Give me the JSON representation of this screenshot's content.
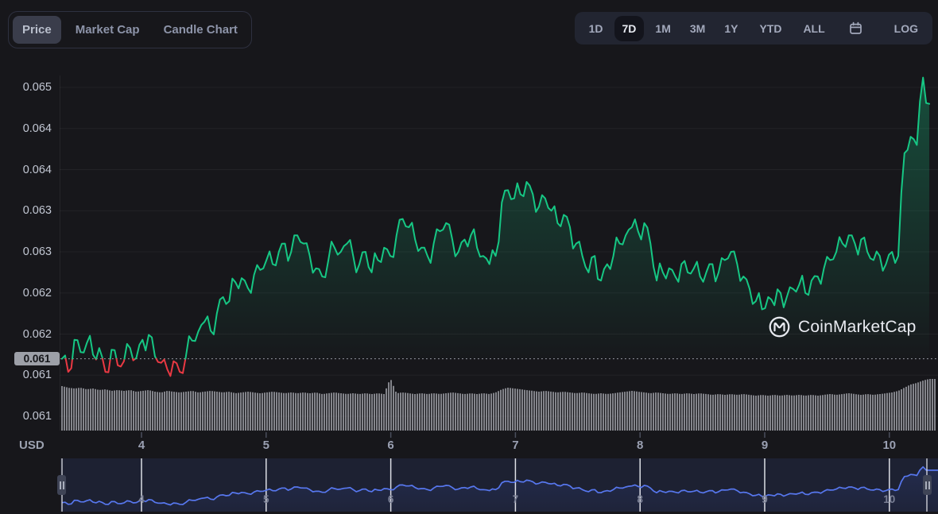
{
  "toolbar": {
    "view_tabs": [
      {
        "label": "Price",
        "selected": true
      },
      {
        "label": "Market Cap",
        "selected": false
      },
      {
        "label": "Candle Chart",
        "selected": false
      }
    ],
    "ranges": [
      {
        "label": "1D",
        "selected": false
      },
      {
        "label": "7D",
        "selected": true
      },
      {
        "label": "1M",
        "selected": false
      },
      {
        "label": "3M",
        "selected": false
      },
      {
        "label": "1Y",
        "selected": false
      },
      {
        "label": "YTD",
        "selected": false
      },
      {
        "label": "ALL",
        "selected": false
      },
      {
        "icon": "calendar"
      },
      {
        "label": "LOG",
        "selected": false
      }
    ]
  },
  "watermark": {
    "text": "CoinMarketCap"
  },
  "axis_unit_label": "USD",
  "chart_data": {
    "type": "line",
    "ylabel": "USD",
    "legend": "none",
    "grid": "horizontal",
    "x_tick_labels": [
      "4",
      "5",
      "6",
      "7",
      "8",
      "9",
      "10"
    ],
    "x_tick_days": [
      4,
      5,
      6,
      7,
      8,
      9,
      10
    ],
    "day_start": 3.362,
    "day_end": 10.322,
    "y_ticks": [
      {
        "price": 0.065,
        "label": "0.065"
      },
      {
        "price": 0.0645,
        "label": "0.064"
      },
      {
        "price": 0.064,
        "label": "0.064"
      },
      {
        "price": 0.0635,
        "label": "0.063"
      },
      {
        "price": 0.063,
        "label": "0.063"
      },
      {
        "price": 0.0625,
        "label": "0.062"
      },
      {
        "price": 0.062,
        "label": "0.062"
      },
      {
        "price": 0.0615,
        "label": "0.061"
      },
      {
        "price": 0.061,
        "label": "0.061"
      }
    ],
    "baseline_price": 0.0617,
    "baseline_label": "0.061",
    "prices_usd": [
      0.0617,
      0.06154,
      0.06193,
      0.06178,
      0.06189,
      0.06175,
      0.06183,
      0.06154,
      0.06181,
      0.06162,
      0.06167,
      0.06183,
      0.06171,
      0.06193,
      0.06199,
      0.06173,
      0.06165,
      0.06157,
      0.06167,
      0.06154,
      0.06173,
      0.06192,
      0.06203,
      0.06215,
      0.06204,
      0.06225,
      0.06245,
      0.0624,
      0.06263,
      0.06268,
      0.06256,
      0.06272,
      0.06278,
      0.0629,
      0.06285,
      0.063,
      0.0631,
      0.063,
      0.0632,
      0.0631,
      0.06295,
      0.0628,
      0.0627,
      0.0629,
      0.06305,
      0.063,
      0.0631,
      0.06295,
      0.06285,
      0.063,
      0.06275,
      0.0629,
      0.06305,
      0.06295,
      0.0632,
      0.0634,
      0.0633,
      0.06315,
      0.06305,
      0.06295,
      0.0631,
      0.06325,
      0.06335,
      0.06315,
      0.063,
      0.06315,
      0.0632,
      0.06305,
      0.06295,
      0.06285,
      0.06295,
      0.0636,
      0.06375,
      0.06365,
      0.0637,
      0.06385,
      0.0637,
      0.06355,
      0.06365,
      0.0635,
      0.06335,
      0.06345,
      0.0633,
      0.0631,
      0.06295,
      0.06275,
      0.06295,
      0.06265,
      0.06285,
      0.06295,
      0.0631,
      0.0632,
      0.0633,
      0.06325,
      0.06335,
      0.0631,
      0.06265,
      0.06275,
      0.0628,
      0.0627,
      0.06285,
      0.06275,
      0.0628,
      0.0627,
      0.06275,
      0.06285,
      0.06275,
      0.0629,
      0.063,
      0.06285,
      0.0627,
      0.06255,
      0.0624,
      0.0623,
      0.06245,
      0.06235,
      0.0625,
      0.06245,
      0.06255,
      0.0626,
      0.0625,
      0.06265,
      0.0627,
      0.0628,
      0.0629,
      0.063,
      0.0631,
      0.0632,
      0.0631,
      0.06315,
      0.063,
      0.0629,
      0.06295,
      0.06285,
      0.063,
      0.06295,
      0.0642,
      0.0644,
      0.0643,
      0.06512,
      0.0648
    ],
    "texture": {
      "midpoint_jitter_usd": [
        0.00012,
        -0.00015,
        7e-05,
        -6e-05,
        0.00016,
        -0.0001,
        3e-05,
        -0.00014,
        9e-05,
        -4e-05,
        0.00013,
        -9e-05,
        5e-05,
        -0.00016,
        0.0001,
        -3e-05,
        8e-05,
        -0.00013,
        4e-05,
        -0.00011,
        0.00015,
        -6e-05,
        2e-05
      ],
      "note": "small oscillation inserted at midpoints of the sampled series to reproduce the high-frequency texture of the drawn line"
    },
    "volume_rel": [
      56,
      54,
      53,
      54,
      52,
      53,
      51,
      52,
      50,
      51,
      50,
      51,
      49,
      50,
      51,
      49,
      48,
      50,
      49,
      48,
      49,
      50,
      48,
      49,
      50,
      49,
      48,
      49,
      47,
      48,
      49,
      48,
      47,
      48,
      49,
      48,
      47,
      48,
      47,
      48,
      47,
      48,
      46,
      47,
      48,
      47,
      46,
      47,
      46,
      47,
      46,
      47,
      46,
      66,
      47,
      48,
      47,
      46,
      47,
      46,
      47,
      46,
      47,
      48,
      47,
      46,
      47,
      46,
      47,
      46,
      48,
      52,
      54,
      53,
      52,
      51,
      50,
      49,
      50,
      49,
      48,
      49,
      48,
      47,
      48,
      47,
      46,
      47,
      46,
      47,
      48,
      49,
      50,
      49,
      48,
      47,
      48,
      47,
      46,
      47,
      46,
      47,
      46,
      47,
      46,
      45,
      46,
      45,
      46,
      45,
      46,
      45,
      44,
      45,
      44,
      45,
      44,
      45,
      44,
      45,
      44,
      45,
      44,
      45,
      46,
      45,
      46,
      47,
      46,
      45,
      46,
      45,
      46,
      47,
      48,
      50,
      54,
      58,
      60,
      63,
      65
    ],
    "colors": {
      "up": "#16c784",
      "down": "#ea3943",
      "volume": "#c0c2ca",
      "navigator_line": "#5777ee",
      "baseline_dotted": "#8e919b"
    }
  }
}
